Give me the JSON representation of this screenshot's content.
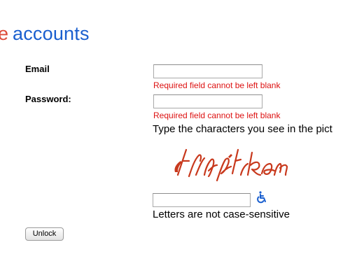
{
  "header": {
    "logo_letter": "e",
    "logo_text": "accounts"
  },
  "form": {
    "email_label": "Email",
    "email_value": "",
    "email_error": "Required field cannot be left blank",
    "password_label": "Password:",
    "password_value": "",
    "password_error": "Required field cannot be left blank",
    "captcha_instruction": "Type the characters you see in the pict",
    "captcha_text": "lrngtkam",
    "captcha_value": "",
    "case_note": "Letters are not case-sensitive",
    "unlock_label": "Unlock"
  },
  "icons": {
    "audio_captcha": "wheelchair-accessibility-icon"
  },
  "colors": {
    "logo_letter": "#dd4b39",
    "logo_text": "#1a5fcf",
    "error": "#dd1111",
    "captcha_ink": "#c8391d",
    "accessibility_icon": "#1a5fcf"
  }
}
